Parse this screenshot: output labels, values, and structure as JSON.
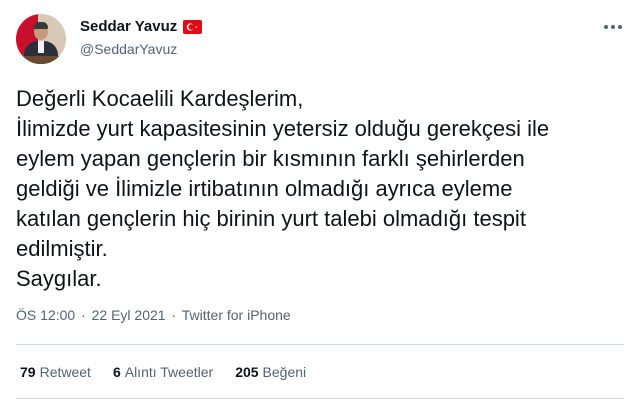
{
  "author": {
    "display_name": "Seddar Yavuz",
    "handle": "@SeddarYavuz",
    "flag_icon": "turkey-flag-icon",
    "flag_color": "#e30a17"
  },
  "more_icon": "more-horizontal-icon",
  "tweet": {
    "lines": [
      "Değerli Kocaelili Kardeşlerim,",
      "İlimizde yurt kapasitesinin yetersiz olduğu gerekçesi ile",
      "eylem yapan gençlerin bir kısmının farklı şehirlerden",
      "geldiği ve İlimizle irtibatının olmadığı ayrıca eyleme",
      "katılan gençlerin hiç birinin yurt talebi olmadığı tespit",
      "edilmiştir.",
      "Saygılar."
    ]
  },
  "meta": {
    "time": "ÖS 12:00",
    "separator": "·",
    "date": "22 Eyl 2021",
    "source": "Twitter for iPhone"
  },
  "stats": {
    "retweets_count": "79",
    "retweets_label": "Retweet",
    "quotes_count": "6",
    "quotes_label": "Alıntı Tweetler",
    "likes_count": "205",
    "likes_label": "Beğeni"
  },
  "colors": {
    "text_primary": "#0f1419",
    "text_secondary": "#536471",
    "divider": "#cfd9de"
  }
}
